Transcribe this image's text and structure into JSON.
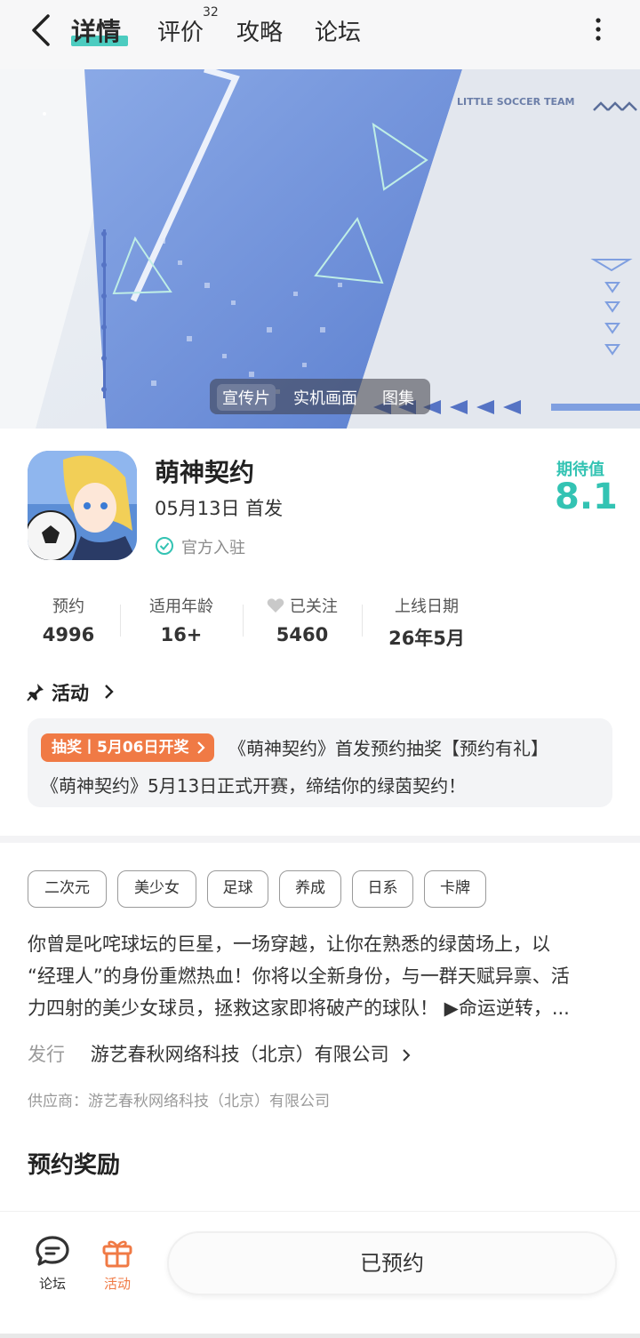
{
  "nav": {
    "tabs": [
      {
        "label": "详情",
        "active": true
      },
      {
        "label": "评价",
        "badge": "32"
      },
      {
        "label": "攻略"
      },
      {
        "label": "论坛"
      }
    ]
  },
  "banner": {
    "media_tabs": [
      "宣传片",
      "实机画面",
      "图集"
    ],
    "selected_media_tab": "宣传片",
    "overlay_text": "LITTLE SOCCER TEAM"
  },
  "game": {
    "title": "萌神契约",
    "release": "05月13日 首发",
    "official": "官方入驻",
    "expectation_label": "期待值",
    "expectation_value": "8.1"
  },
  "stats": [
    {
      "label": "预约",
      "value": "4996"
    },
    {
      "label": "适用年龄",
      "value": "16+"
    },
    {
      "label": "已关注",
      "value": "5460"
    },
    {
      "label": "上线日期",
      "value": "26年5月"
    }
  ],
  "activity": {
    "title": "活动",
    "badge": "抽奖丨5月06日开奖",
    "line1": "《萌神契约》首发预约抽奖【预约有礼】",
    "line2": "《萌神契约》5月13日正式开赛，缔结你的绿茵契约！"
  },
  "tags": [
    "二次元",
    "美少女",
    "足球",
    "养成",
    "日系",
    "卡牌"
  ],
  "description": [
    "你曾是叱咤球坛的巨星，一场穿越，让你在熟悉的绿茵场上，以",
    "“经理人”的身份重燃热血！你将以全新身份，与一群天赋异禀、活",
    "力四射的美少女球员，拯救这家即将破产的球队！ ▶命运逆转，..."
  ],
  "publisher": {
    "label": "发行",
    "name": "游艺春秋网络科技（北京）有限公司"
  },
  "supplier": "供应商：游艺春秋网络科技（北京）有限公司",
  "rewards_title": "预约奖励",
  "bottom": {
    "forum_label": "论坛",
    "activity_label": "活动",
    "reserve_button": "已预约"
  },
  "colors": {
    "accent": "#33c3b3",
    "activity_orange": "#f07a45"
  }
}
